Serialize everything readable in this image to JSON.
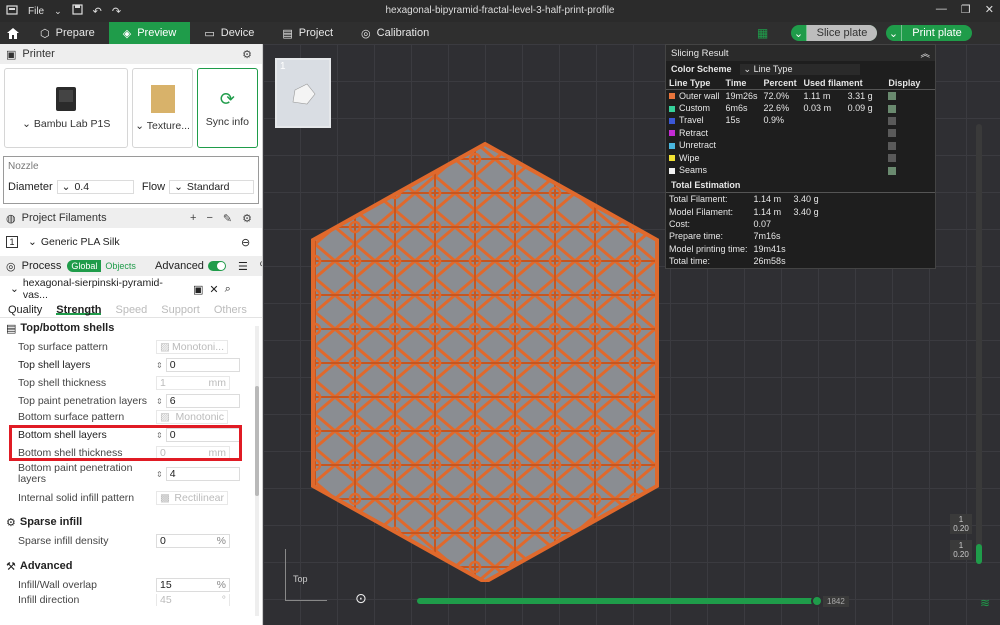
{
  "window": {
    "title": "hexagonal-bipyramid-fractal-level-3-half-print-profile",
    "file_menu": "File"
  },
  "toolbar": {
    "tabs": [
      {
        "label": "Prepare"
      },
      {
        "label": "Preview"
      },
      {
        "label": "Device"
      },
      {
        "label": "Project"
      },
      {
        "label": "Calibration"
      }
    ],
    "slice_button": "Slice plate",
    "print_button": "Print plate"
  },
  "sidebar": {
    "printer": {
      "header": "Printer",
      "printer_name": "Bambu Lab P1S",
      "texture_label": "Texture...",
      "sync_label": "Sync info"
    },
    "nozzle": {
      "title": "Nozzle",
      "diameter_label": "Diameter",
      "diameter_value": "0.4",
      "flow_label": "Flow",
      "flow_value": "Standard"
    },
    "filaments": {
      "header": "Project Filaments",
      "items": [
        {
          "index": "1",
          "name": "Generic PLA Silk"
        }
      ]
    },
    "process": {
      "header": "Process",
      "global_label": "Global",
      "objects_label": "Objects",
      "advanced_label": "Advanced",
      "preset": "hexagonal-sierpinski-pyramid-vas...",
      "tabs": [
        "Quality",
        "Strength",
        "Speed",
        "Support",
        "Others"
      ],
      "groups": {
        "top_bottom": {
          "title": "Top/bottom shells",
          "params": [
            {
              "label": "Top surface pattern",
              "value": "Monotoni..."
            },
            {
              "label": "Top shell layers",
              "value": "0"
            },
            {
              "label": "Top shell thickness",
              "value": "1",
              "unit": "mm"
            },
            {
              "label": "Top paint penetration layers",
              "value": "6"
            },
            {
              "label": "Bottom surface pattern",
              "value": "Monotonic"
            },
            {
              "label": "Bottom shell layers",
              "value": "0"
            },
            {
              "label": "Bottom shell thickness",
              "value": "0",
              "unit": "mm"
            },
            {
              "label": "Bottom paint penetration layers",
              "value": "4"
            },
            {
              "label": "Internal solid infill pattern",
              "value": "Rectilinear"
            }
          ]
        },
        "sparse": {
          "title": "Sparse infill",
          "params": [
            {
              "label": "Sparse infill density",
              "value": "0",
              "unit": "%"
            }
          ]
        },
        "advanced": {
          "title": "Advanced",
          "params": [
            {
              "label": "Infill/Wall overlap",
              "value": "15",
              "unit": "%"
            },
            {
              "label": "Infill direction",
              "value": "45",
              "unit": "°"
            }
          ]
        }
      }
    }
  },
  "viewport": {
    "plate_number": "1",
    "view_label": "Top",
    "slider_max_layer": "1842",
    "layer_top": {
      "index": "1",
      "height": "0.20"
    },
    "layer_bottom": {
      "index": "1",
      "height": "0.20"
    }
  },
  "slicing_result": {
    "title": "Slicing Result",
    "color_scheme_label": "Color Scheme",
    "color_scheme_value": "Line Type",
    "columns": [
      "Line Type",
      "Time",
      "Percent",
      "Used filament",
      "",
      "Display"
    ],
    "rows": [
      {
        "type": "Outer wall",
        "color": "#e8743b",
        "time": "19m26s",
        "percent": "72.0%",
        "length": "1.11 m",
        "weight": "3.31 g",
        "display": true
      },
      {
        "type": "Custom",
        "color": "#36d19a",
        "time": "6m6s",
        "percent": "22.6%",
        "length": "0.03 m",
        "weight": "0.09 g",
        "display": true
      },
      {
        "type": "Travel",
        "color": "#3b57d6",
        "time": "15s",
        "percent": "0.9%",
        "length": "",
        "weight": "",
        "display": false
      },
      {
        "type": "Retract",
        "color": "#c32bd4",
        "time": "",
        "percent": "",
        "length": "",
        "weight": "",
        "display": false
      },
      {
        "type": "Unretract",
        "color": "#49b6de",
        "time": "",
        "percent": "",
        "length": "",
        "weight": "",
        "display": false
      },
      {
        "type": "Wipe",
        "color": "#f2e233",
        "time": "",
        "percent": "",
        "length": "",
        "weight": "",
        "display": false
      },
      {
        "type": "Seams",
        "color": "#f2f2f2",
        "time": "",
        "percent": "",
        "length": "",
        "weight": "",
        "display": true
      }
    ],
    "total_title": "Total Estimation",
    "totals": [
      {
        "label": "Total Filament:",
        "value": "1.14 m",
        "extra": "3.40 g"
      },
      {
        "label": "Model Filament:",
        "value": "1.14 m",
        "extra": "3.40 g"
      },
      {
        "label": "Cost:",
        "value": "0.07",
        "extra": ""
      },
      {
        "label": "Prepare time:",
        "value": "7m16s",
        "extra": ""
      },
      {
        "label": "Model printing time:",
        "value": "19m41s",
        "extra": ""
      },
      {
        "label": "Total time:",
        "value": "26m58s",
        "extra": ""
      }
    ]
  },
  "colors": {
    "accent": "#1f9c4a",
    "model_orange": "#e0692c",
    "highlight": "#e01b24"
  }
}
